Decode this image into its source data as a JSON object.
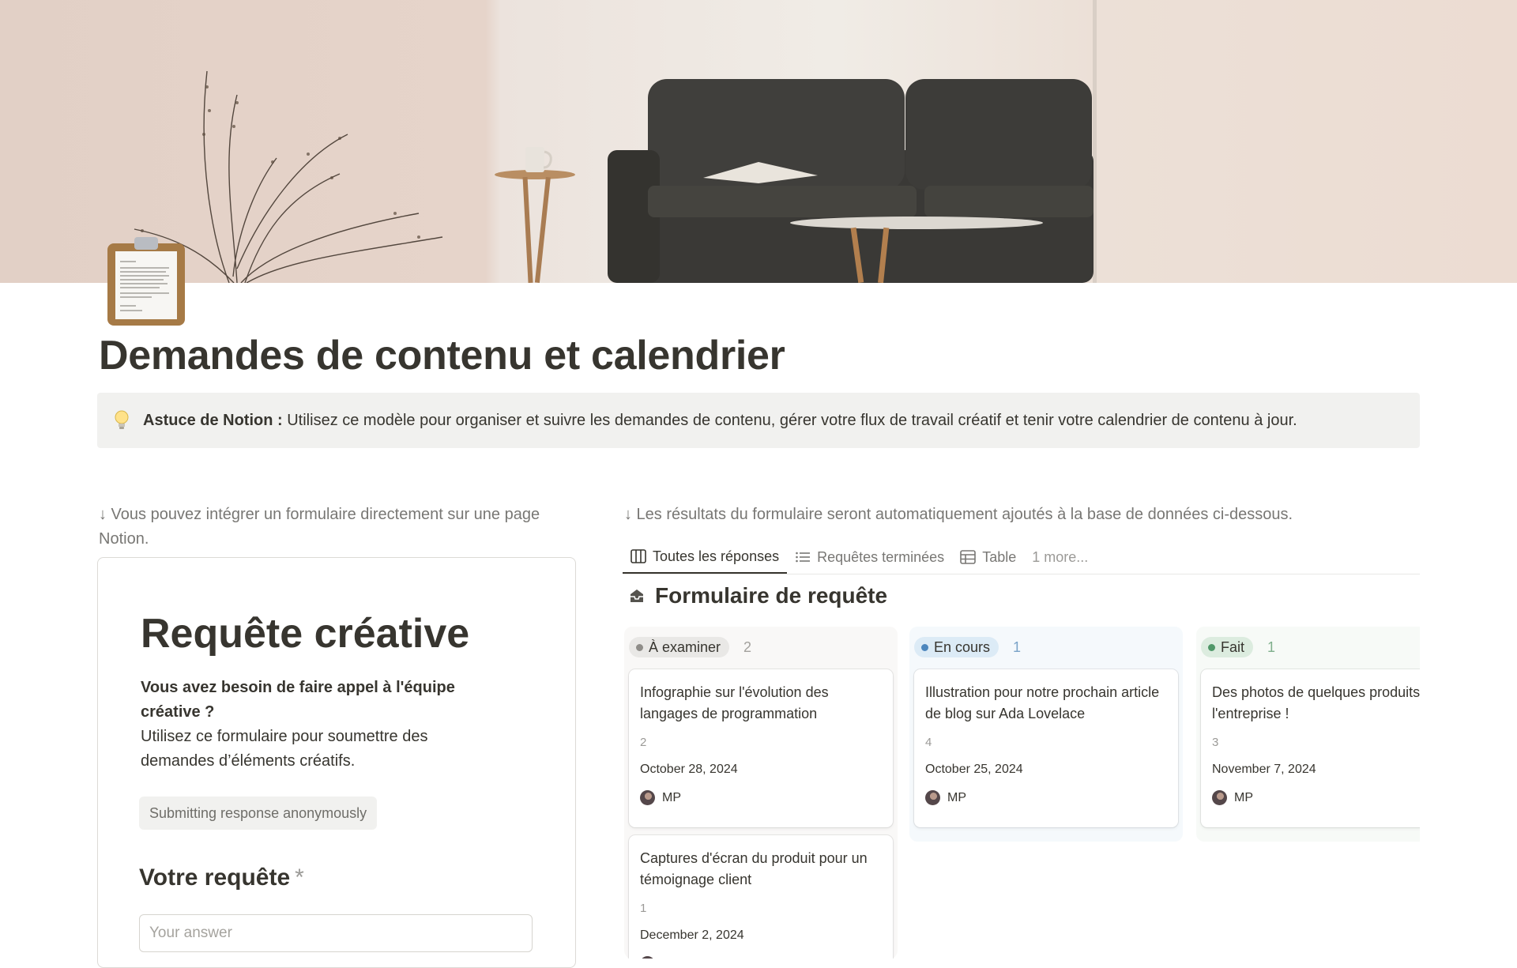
{
  "page": {
    "title": "Demandes de contenu et calendrier",
    "cover_icon": "clipboard-icon"
  },
  "callout": {
    "icon": "lightbulb-icon",
    "label": "Astuce de Notion :",
    "text": "Utilisez ce modèle pour organiser et suivre les demandes de contenu, gérer votre flux de travail créatif et tenir votre calendrier de contenu à jour."
  },
  "left": {
    "note": "↓ Vous pouvez intégrer un formulaire directement sur une page Notion.",
    "form": {
      "title": "Requête créative",
      "desc_bold": "Vous avez besoin de faire appel à l'équipe créative ?",
      "desc": "Utilisez ce formulaire pour soumettre des demandes d’éléments créatifs.",
      "anonymous": "Submitting response anonymously",
      "question": "Votre requête",
      "required_mark": "*",
      "answer_placeholder": "Your answer"
    }
  },
  "right": {
    "note": "↓ Les résultats du formulaire seront automatiquement ajoutés à la base de données ci-dessous.",
    "tabs": [
      {
        "label": "Toutes les réponses",
        "icon": "board-icon",
        "active": true
      },
      {
        "label": "Requêtes terminées",
        "icon": "list-icon",
        "active": false
      },
      {
        "label": "Table",
        "icon": "table-icon",
        "active": false
      },
      {
        "label": "1 more...",
        "active": false
      }
    ],
    "database_title": "Formulaire de requête",
    "database_icon": "inbox-tray-icon",
    "columns": [
      {
        "status": "À examiner",
        "count": "2",
        "pill_bg": "#e9e8e6",
        "dot": "#8f8d89",
        "count_color": "#a3a19d",
        "cards": [
          {
            "title": "Infographie sur l'évolution des langages de programmation",
            "num": "2",
            "date": "October 28, 2024",
            "person": "MP"
          },
          {
            "title": "Captures d'écran du produit pour un témoignage client",
            "num": "1",
            "date": "December 2, 2024",
            "person": "MP"
          }
        ]
      },
      {
        "status": "En cours",
        "count": "1",
        "pill_bg": "#dcebf6",
        "dot": "#4c86bd",
        "count_color": "#7aa3c8",
        "cards": [
          {
            "title": "Illustration pour notre prochain article de blog sur Ada Lovelace",
            "num": "4",
            "date": "October 25, 2024",
            "person": "MP"
          }
        ]
      },
      {
        "status": "Fait",
        "count": "1",
        "pill_bg": "#dcecdf",
        "dot": "#4f9768",
        "count_color": "#7faf8c",
        "cards": [
          {
            "title": "Des photos de quelques produits de l'entreprise !",
            "num": "3",
            "date": "November 7, 2024",
            "person": "MP"
          }
        ]
      }
    ]
  }
}
